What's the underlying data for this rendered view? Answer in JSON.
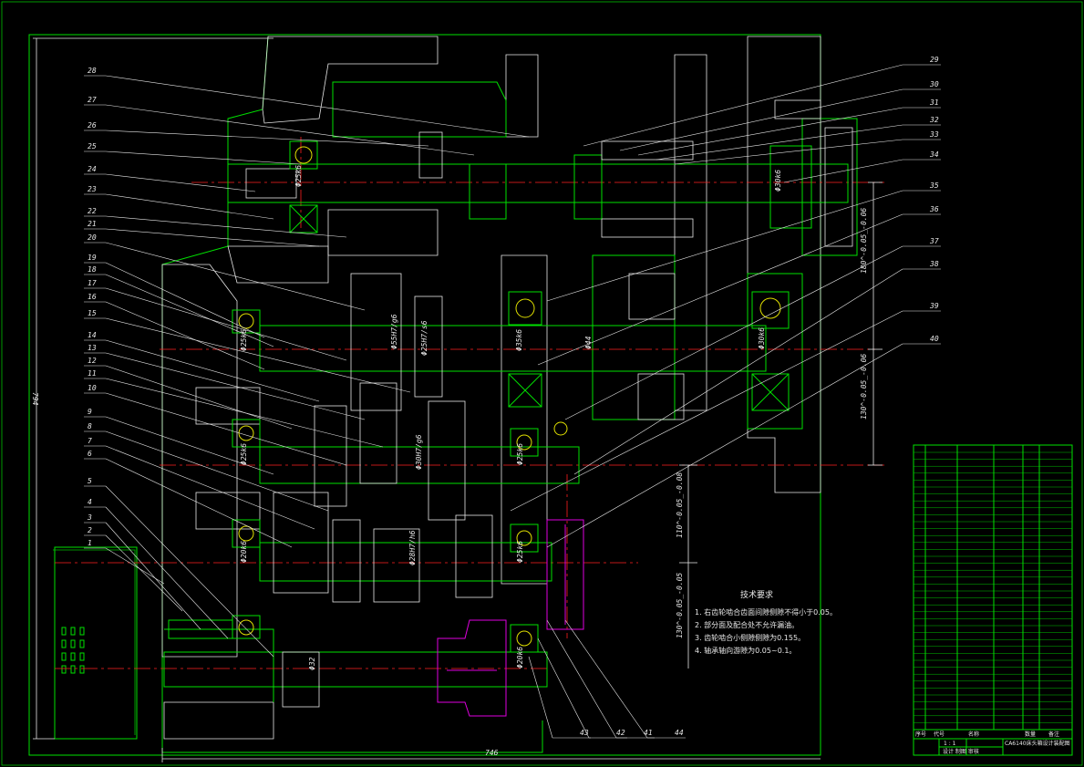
{
  "part_numbers": [
    "1",
    "2",
    "3",
    "4",
    "5",
    "6",
    "7",
    "8",
    "9",
    "10",
    "11",
    "12",
    "13",
    "14",
    "15",
    "16",
    "17",
    "18",
    "19",
    "20",
    "21",
    "22",
    "23",
    "24",
    "25",
    "26",
    "27",
    "28",
    "29",
    "30",
    "31",
    "32",
    "33",
    "34",
    "35",
    "36",
    "37",
    "38",
    "39",
    "40",
    "41",
    "42",
    "43",
    "44"
  ],
  "dimensions": {
    "overall_height": "794",
    "overall_width": "746",
    "center_top": "180^-0.05_-0.06",
    "center_mid": "130^-0.05_-0.06",
    "center_right": "110^-0.05_-0.08",
    "center_bottom": "130^-0.05_-0.05"
  },
  "shaft_fits": [
    "Φ25k6",
    "Φ25H7/s6",
    "Φ35k6",
    "Φ55H7/g6",
    "Φ30k6",
    "Φ44",
    "Φ30k6",
    "Φ25k6",
    "Φ30H7/g6",
    "Φ25k6",
    "Φ25k6",
    "Φ28H7/h6",
    "Φ25k6",
    "Φ20k6",
    "Φ20k6",
    "Φ32"
  ],
  "technical_requirements": {
    "title": "技术要求",
    "items": [
      "1. 右齿轮啮合齿面间隙侧隙不得小于0.05。",
      "2. 部分面及配合处不允许漏油。",
      "3. 齿轮啮合小侧隙侧隙为0.155。",
      "4. 轴承轴向游隙为0.05~0.1。"
    ]
  },
  "title_block": {
    "headers": [
      "序号",
      "代号",
      "名称",
      "数量",
      "备注"
    ],
    "scale": "1 : 1",
    "drawing_name": "CA6140床头箱设计装配图",
    "footer": "设计 制图 审核"
  }
}
